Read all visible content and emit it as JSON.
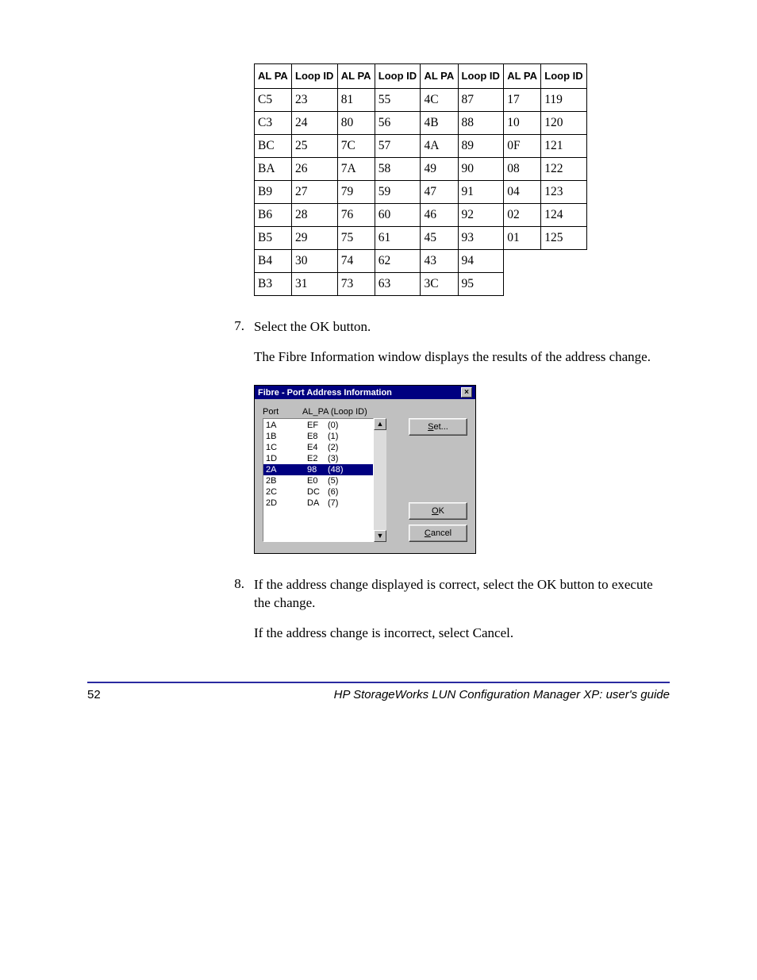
{
  "table": {
    "headers": {
      "alpa": "AL PA",
      "loopid": "Loop ID"
    },
    "rows": [
      [
        "C5",
        "23",
        "81",
        "55",
        "4C",
        "87",
        "17",
        "119"
      ],
      [
        "C3",
        "24",
        "80",
        "56",
        "4B",
        "88",
        "10",
        "120"
      ],
      [
        "BC",
        "25",
        "7C",
        "57",
        "4A",
        "89",
        "0F",
        "121"
      ],
      [
        "BA",
        "26",
        "7A",
        "58",
        "49",
        "90",
        "08",
        "122"
      ],
      [
        "B9",
        "27",
        "79",
        "59",
        "47",
        "91",
        "04",
        "123"
      ],
      [
        "B6",
        "28",
        "76",
        "60",
        "46",
        "92",
        "02",
        "124"
      ],
      [
        "B5",
        "29",
        "75",
        "61",
        "45",
        "93",
        "01",
        "125"
      ],
      [
        "B4",
        "30",
        "74",
        "62",
        "43",
        "94",
        "",
        ""
      ],
      [
        "B3",
        "31",
        "73",
        "63",
        "3C",
        "95",
        "",
        ""
      ]
    ]
  },
  "steps": {
    "s7": {
      "num": "7.",
      "line1": "Select the OK button.",
      "line2": "The Fibre Information window displays the results of the address change."
    },
    "s8": {
      "num": "8.",
      "line1": "If the address change displayed is correct, select the OK button to execute the change.",
      "line2": "If the address change is incorrect, select Cancel."
    }
  },
  "dialog": {
    "title": "Fibre - Port Address Information",
    "close_glyph": "×",
    "headers": {
      "port": "Port",
      "alpa": "AL_PA (Loop ID)"
    },
    "items": [
      {
        "port": "1A",
        "alpa": "EF",
        "loop": "(0)",
        "selected": false
      },
      {
        "port": "1B",
        "alpa": "E8",
        "loop": "(1)",
        "selected": false
      },
      {
        "port": "1C",
        "alpa": "E4",
        "loop": "(2)",
        "selected": false
      },
      {
        "port": "1D",
        "alpa": "E2",
        "loop": "(3)",
        "selected": false
      },
      {
        "port": "2A",
        "alpa": "98",
        "loop": "(48)",
        "selected": true
      },
      {
        "port": "2B",
        "alpa": "E0",
        "loop": "(5)",
        "selected": false
      },
      {
        "port": "2C",
        "alpa": "DC",
        "loop": "(6)",
        "selected": false
      },
      {
        "port": "2D",
        "alpa": "DA",
        "loop": "(7)",
        "selected": false
      }
    ],
    "scroll": {
      "up": "▲",
      "down": "▼"
    },
    "buttons": {
      "set": {
        "pre": "",
        "u": "S",
        "post": "et..."
      },
      "ok": {
        "pre": "",
        "u": "O",
        "post": "K"
      },
      "cancel": {
        "pre": "",
        "u": "C",
        "post": "ancel"
      }
    }
  },
  "footer": {
    "page": "52",
    "title": "HP StorageWorks LUN Configuration Manager XP: user's guide"
  }
}
